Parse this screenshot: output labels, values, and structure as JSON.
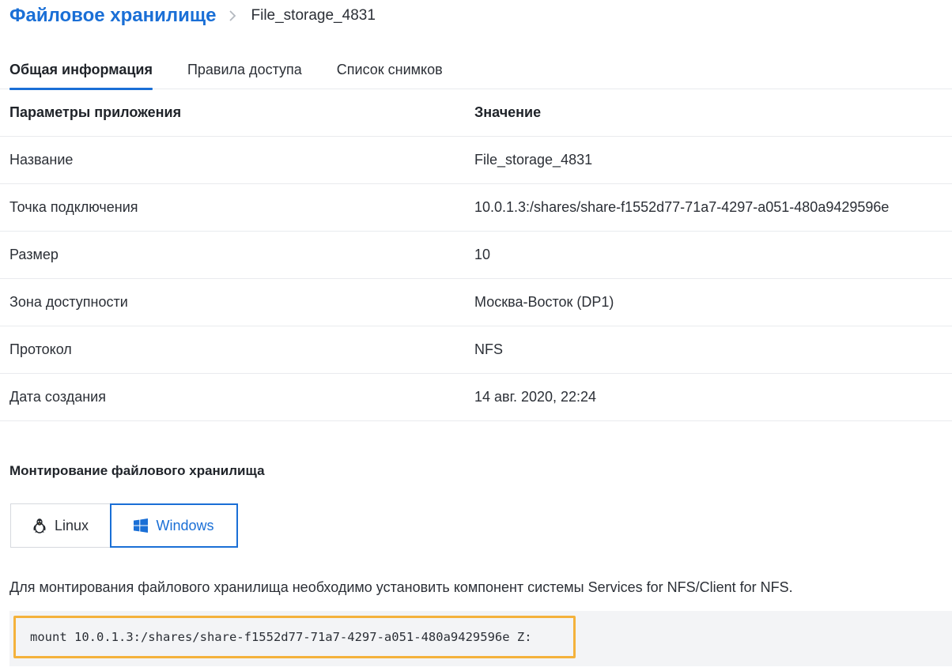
{
  "breadcrumb": {
    "root": "Файловое хранилище",
    "current": "File_storage_4831"
  },
  "tabs": [
    {
      "label": "Общая информация",
      "active": true
    },
    {
      "label": "Правила доступа",
      "active": false
    },
    {
      "label": "Список снимков",
      "active": false
    }
  ],
  "table": {
    "header": {
      "key": "Параметры приложения",
      "value": "Значение"
    },
    "rows": [
      {
        "key": "Название",
        "value": "File_storage_4831"
      },
      {
        "key": "Точка подключения",
        "value": "10.0.1.3:/shares/share-f1552d77-71a7-4297-a051-480a9429596e"
      },
      {
        "key": "Размер",
        "value": "10"
      },
      {
        "key": "Зона доступности",
        "value": "Москва-Восток (DP1)"
      },
      {
        "key": "Протокол",
        "value": "NFS"
      },
      {
        "key": "Дата создания",
        "value": "14 авг. 2020, 22:24"
      }
    ]
  },
  "mount": {
    "title": "Монтирование файлового хранилища",
    "os_options": [
      {
        "label": "Linux",
        "icon": "linux-icon",
        "selected": false
      },
      {
        "label": "Windows",
        "icon": "windows-icon",
        "selected": true
      }
    ],
    "description": "Для монтирования файлового хранилища необходимо установить компонент системы Services for NFS/Client for NFS.",
    "command": "mount 10.0.1.3:/shares/share-f1552d77-71a7-4297-a051-480a9429596e Z:"
  },
  "colors": {
    "accent": "#1a6fd6",
    "highlight": "#f4b23c",
    "code_bg": "#f3f4f6"
  }
}
